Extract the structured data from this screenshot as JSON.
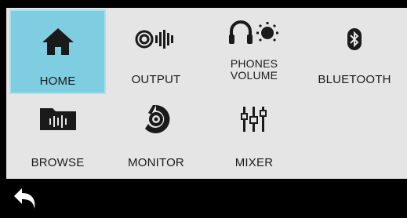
{
  "menu": {
    "items": [
      {
        "id": "home",
        "label": "HOME",
        "icon": "home-icon",
        "selected": true
      },
      {
        "id": "output",
        "label": "OUTPUT",
        "icon": "output-icon"
      },
      {
        "id": "phones_volume",
        "label_line1": "PHONES",
        "label_line2": "VOLUME",
        "icon": "headphones-volume-icon"
      },
      {
        "id": "bluetooth",
        "label": "BLUETOOTH",
        "icon": "bluetooth-icon"
      },
      {
        "id": "browse",
        "label": "BROWSE",
        "icon": "browse-folder-icon"
      },
      {
        "id": "monitor",
        "label": "MONITOR",
        "icon": "monitor-icon"
      },
      {
        "id": "mixer",
        "label": "MIXER",
        "icon": "mixer-icon"
      }
    ]
  },
  "footer": {
    "back_icon": "back-arrow-icon"
  },
  "colors": {
    "background": "#e5e5e5",
    "selected": "#7fcde0",
    "icon": "#1a1a1a",
    "bar": "#000000"
  }
}
